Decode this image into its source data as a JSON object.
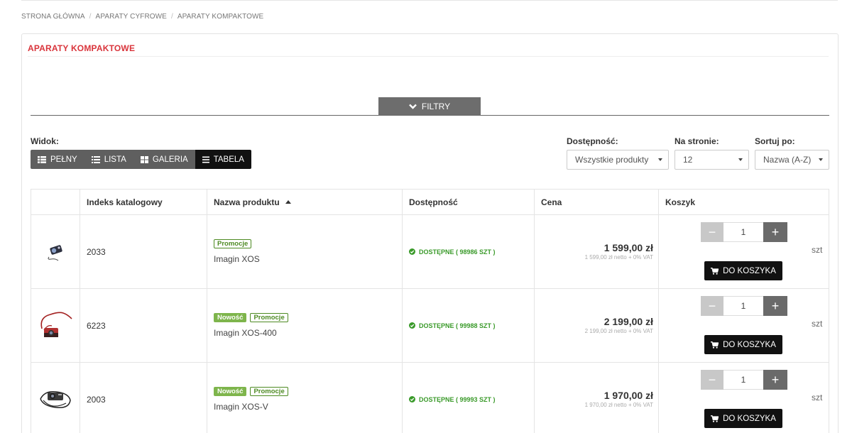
{
  "breadcrumb": [
    "STRONA GŁÓWNA",
    "APARATY CYFROWE",
    "APARATY KOMPAKTOWE"
  ],
  "page_title": "APARATY KOMPAKTOWE",
  "filters_label": "FILTRY",
  "view": {
    "label": "Widok:",
    "buttons": [
      "PEŁNY",
      "LISTA",
      "GALERIA",
      "TABELA"
    ],
    "active": "TABELA"
  },
  "availability_filter": {
    "label": "Dostępność:",
    "value": "Wszystkie produkty"
  },
  "per_page": {
    "label": "Na stronie:",
    "value": "12"
  },
  "sort": {
    "label": "Sortuj po:",
    "value": "Nazwa (A-Z)"
  },
  "table": {
    "headers": [
      "Indeks katalogowy",
      "Nazwa produktu",
      "Dostępność",
      "Cena",
      "Koszyk"
    ],
    "sort_column": "Nazwa produktu",
    "rows": [
      {
        "index": "2033",
        "badges": [
          "Promocje"
        ],
        "name": "Imagin XOS",
        "availability": "DOSTĘPNE ( 98986 SZT )",
        "price": "1 599,00 zł",
        "price_net": "1 599,00 zł netto + 0% VAT",
        "qty": "1",
        "unit": "szt",
        "add_label": "DO KOSZYKA"
      },
      {
        "index": "6223",
        "badges": [
          "Nowość",
          "Promocje"
        ],
        "name": "Imagin XOS-400",
        "availability": "DOSTĘPNE ( 99988 SZT )",
        "price": "2 199,00 zł",
        "price_net": "2 199,00 zł netto + 0% VAT",
        "qty": "1",
        "unit": "szt",
        "add_label": "DO KOSZYKA"
      },
      {
        "index": "2003",
        "badges": [
          "Nowość",
          "Promocje"
        ],
        "name": "Imagin XOS-V",
        "availability": "DOSTĘPNE ( 99993 SZT )",
        "price": "1 970,00 zł",
        "price_net": "1 970,00 zł netto + 0% VAT",
        "qty": "1",
        "unit": "szt",
        "add_label": "DO KOSZYKA"
      }
    ]
  },
  "colors": {
    "title_red": "#d9343b",
    "available_green": "#3a9a2a",
    "new_badge": "#7eb54c",
    "promo_badge": "#4d8a22",
    "dark_button": "#111111"
  },
  "icons": [
    "chevron-down-icon",
    "list-full-icon",
    "list-icon",
    "grid-icon",
    "table-icon",
    "check-circle-icon",
    "cart-icon"
  ]
}
